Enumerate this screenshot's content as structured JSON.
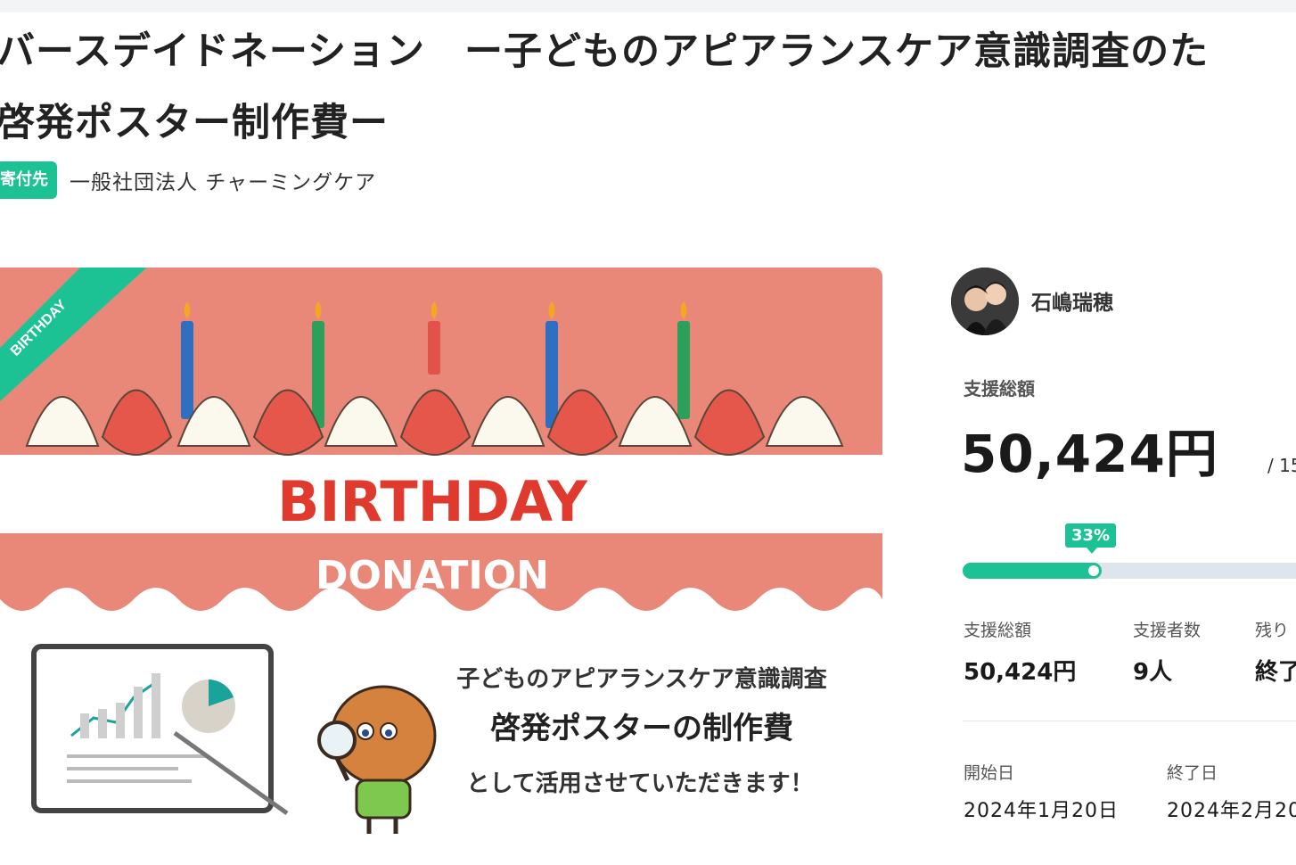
{
  "project": {
    "title_line1": "バースデイドネーション　ー子どものアピアランスケア意識調査のた",
    "title_line2": "啓発ポスター制作費ー",
    "recipient_badge": "寄付先",
    "recipient_name": "一般社団法人 チャーミングケア"
  },
  "hero": {
    "ribbon_text": "BIRTHDAY",
    "heading": "BIRTHDAY",
    "subheading": "DONATION",
    "line1": "子どものアピアランスケア意識調査",
    "line2": "啓発ポスターの制作費",
    "line3": "として活用させていただきます！"
  },
  "owner": {
    "name": "石嶋瑞穂"
  },
  "funding": {
    "total_label": "支援総額",
    "total_value": "50,424円",
    "goal_text": "/ 15",
    "percent_label": "33%",
    "percent": 33
  },
  "stats": [
    {
      "label": "支援総額",
      "value": "50,424円"
    },
    {
      "label": "支援者数",
      "value": "9人"
    },
    {
      "label": "残り",
      "value": "終了"
    }
  ],
  "dates": [
    {
      "label": "開始日",
      "value": "2024年1月20日"
    },
    {
      "label": "終了日",
      "value": "2024年2月20"
    }
  ],
  "colors": {
    "accent": "#1cc293",
    "salmon": "#e98878",
    "heading_red": "#e03a2e"
  }
}
